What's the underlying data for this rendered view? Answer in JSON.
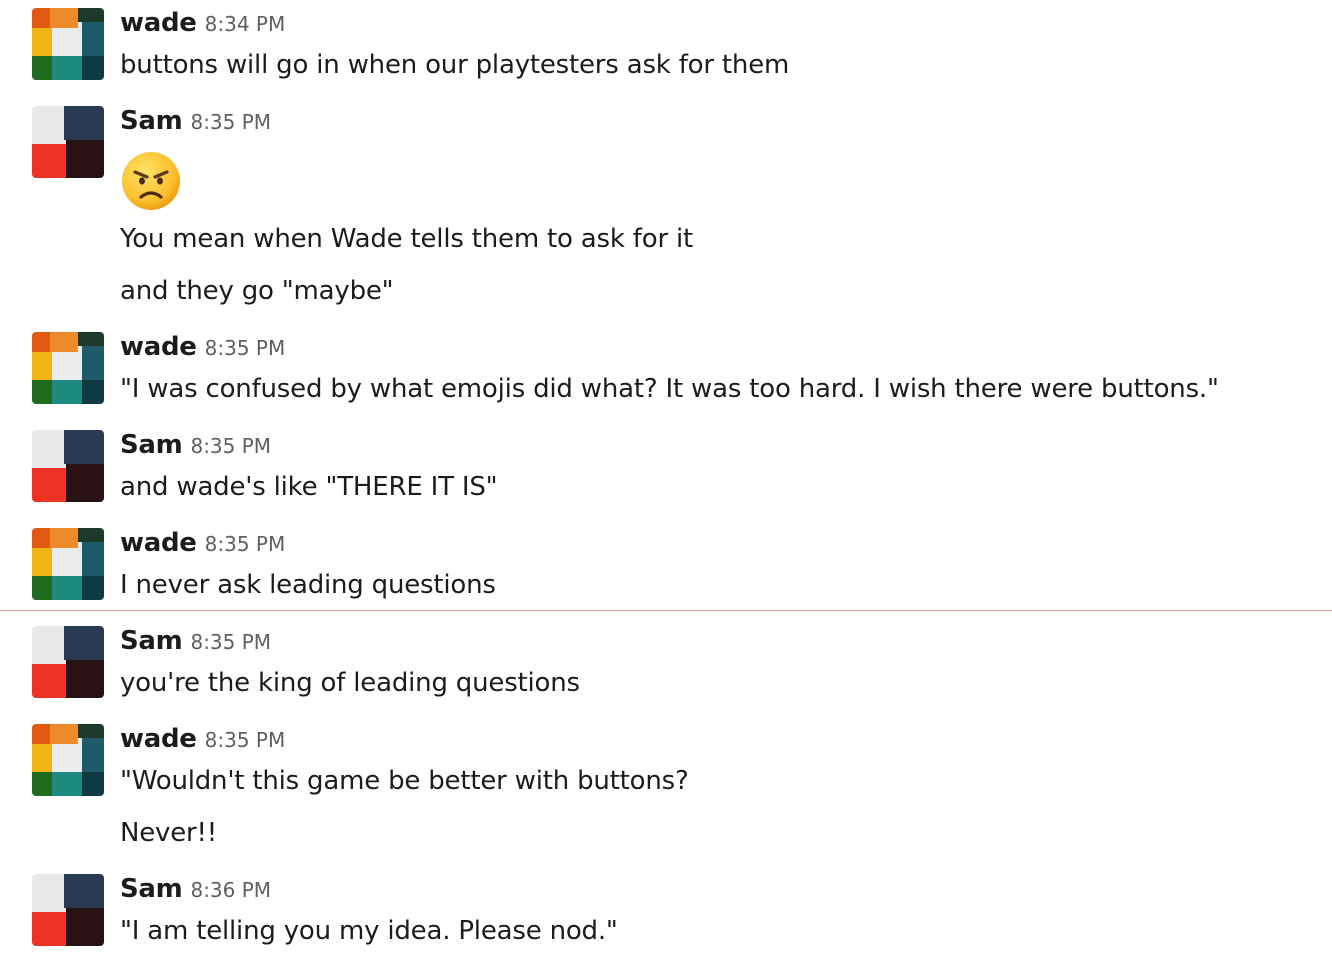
{
  "colors": {
    "new_messages_divider": "#e8a0a0",
    "author_text": "#1d1c1d",
    "timestamp_text": "#616061",
    "emoji_face": "#fbc02d"
  },
  "messages": [
    {
      "author": "wade",
      "time": "8:34 PM",
      "lines": [
        "buttons will go in when our playtesters ask for them"
      ]
    },
    {
      "author": "Sam",
      "time": "8:35 PM",
      "emoji": "angry-face-emoji",
      "lines": [
        "You mean when Wade tells them to ask for it",
        "and they go \"maybe\""
      ]
    },
    {
      "author": "wade",
      "time": "8:35 PM",
      "lines": [
        "\"I was confused by what emojis did what? It was too hard. I wish there were buttons.\""
      ]
    },
    {
      "author": "Sam",
      "time": "8:35 PM",
      "lines": [
        "and wade's like \"THERE IT IS\""
      ]
    },
    {
      "author": "wade",
      "time": "8:35 PM",
      "lines": [
        "I never ask leading questions"
      ]
    },
    {
      "author": "Sam",
      "time": "8:35 PM",
      "lines": [
        "you're the king of leading questions"
      ]
    },
    {
      "author": "wade",
      "time": "8:35 PM",
      "lines": [
        "\"Wouldn't this game be better with buttons?",
        "Never!!"
      ]
    },
    {
      "author": "Sam",
      "time": "8:36 PM",
      "lines": [
        "\"I am telling you my idea. Please nod.\""
      ]
    }
  ]
}
